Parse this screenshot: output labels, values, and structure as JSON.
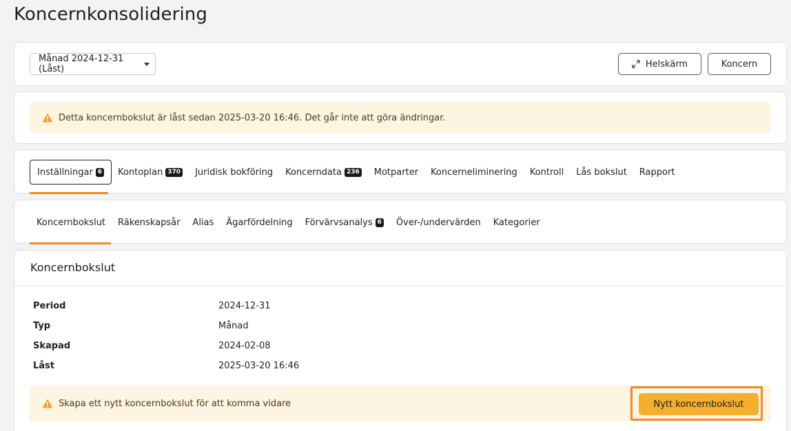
{
  "page": {
    "title": "Koncernkonsolidering"
  },
  "toolbar": {
    "period_select": "Månad 2024-12-31 (Låst)",
    "fullscreen_label": "Helskärm",
    "koncern_label": "Koncern"
  },
  "lock_alert": {
    "text": "Detta koncernbokslut är låst sedan 2025-03-20 16:46. Det går inte att göra ändringar.",
    "icon": "warning-icon"
  },
  "tabs": [
    {
      "label": "Inställningar",
      "badge": "6",
      "active": true
    },
    {
      "label": "Kontoplan",
      "badge": "370"
    },
    {
      "label": "Juridisk bokföring",
      "badge": ""
    },
    {
      "label": "Koncerndata",
      "badge": "236"
    },
    {
      "label": "Motparter",
      "badge": ""
    },
    {
      "label": "Koncerneliminering",
      "badge": ""
    },
    {
      "label": "Kontroll",
      "badge": ""
    },
    {
      "label": "Lås bokslut",
      "badge": ""
    },
    {
      "label": "Rapport",
      "badge": ""
    }
  ],
  "subtabs": [
    {
      "label": "Koncernbokslut",
      "badge": "",
      "active": true
    },
    {
      "label": "Räkenskapsår",
      "badge": ""
    },
    {
      "label": "Alias",
      "badge": ""
    },
    {
      "label": "Ägarfördelning",
      "badge": ""
    },
    {
      "label": "Förvärvsanalys",
      "badge": "6"
    },
    {
      "label": "Över-/undervärden",
      "badge": ""
    },
    {
      "label": "Kategorier",
      "badge": ""
    }
  ],
  "detail": {
    "title": "Koncernbokslut",
    "rows": [
      {
        "label": "Period",
        "value": "2024-12-31"
      },
      {
        "label": "Typ",
        "value": "Månad"
      },
      {
        "label": "Skapad",
        "value": "2024-02-08"
      },
      {
        "label": "Låst",
        "value": "2025-03-20 16:46"
      }
    ],
    "cta_text": "Skapa ett nytt koncernbokslut för att komma vidare",
    "cta_button": "Nytt koncernbokslut"
  },
  "colors": {
    "accent": "#f08a24",
    "primary_button": "#f5ae2d",
    "alert_bg": "#fdf4e1",
    "warning_icon": "#f0a020"
  }
}
